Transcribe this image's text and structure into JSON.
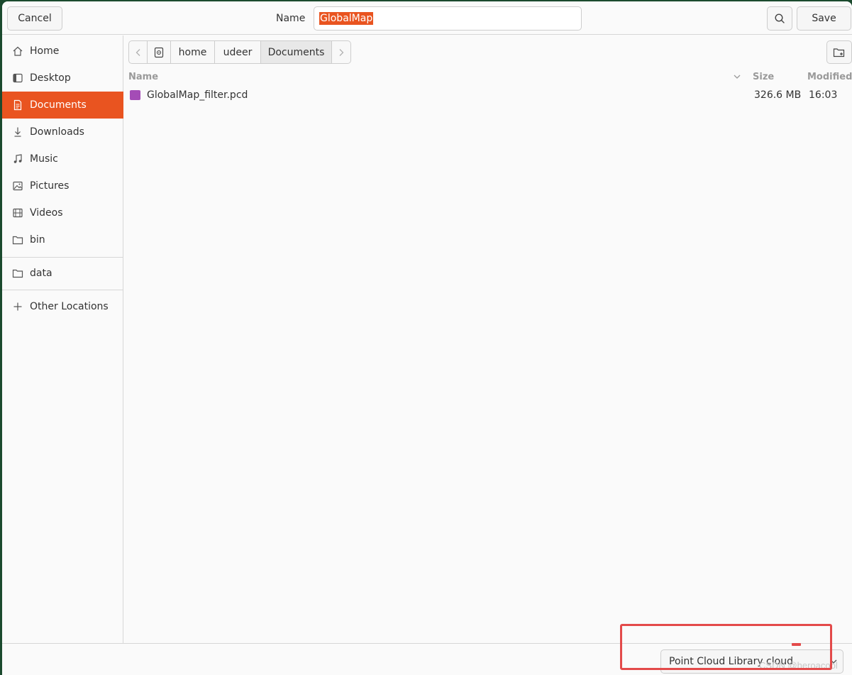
{
  "header": {
    "cancel_label": "Cancel",
    "name_label": "Name",
    "name_value": "GlobalMap",
    "save_label": "Save",
    "search_icon": "search-icon"
  },
  "sidebar": {
    "items": [
      {
        "label": "Home",
        "icon": "home-icon"
      },
      {
        "label": "Desktop",
        "icon": "desktop-icon"
      },
      {
        "label": "Documents",
        "icon": "document-icon",
        "active": true
      },
      {
        "label": "Downloads",
        "icon": "download-icon"
      },
      {
        "label": "Music",
        "icon": "music-icon"
      },
      {
        "label": "Pictures",
        "icon": "picture-icon"
      },
      {
        "label": "Videos",
        "icon": "video-icon"
      },
      {
        "label": "bin",
        "icon": "folder-icon"
      },
      {
        "label": "data",
        "icon": "folder-icon"
      },
      {
        "label": "Other Locations",
        "icon": "plus-icon"
      }
    ]
  },
  "pathbar": {
    "crumbs": [
      "home",
      "udeer",
      "Documents"
    ]
  },
  "filelist": {
    "columns": {
      "name": "Name",
      "size": "Size",
      "modified": "Modified"
    },
    "rows": [
      {
        "name": "GlobalMap_filter.pcd",
        "size": "326.6 MB",
        "modified": "16:03"
      }
    ]
  },
  "footer": {
    "filter_value": "Point Cloud Library cloud",
    "watermark": "CSDN @heroacool"
  },
  "colors": {
    "accent": "#e95420",
    "highlight": "#e34a4a",
    "file_icon": "#a44cb6"
  }
}
